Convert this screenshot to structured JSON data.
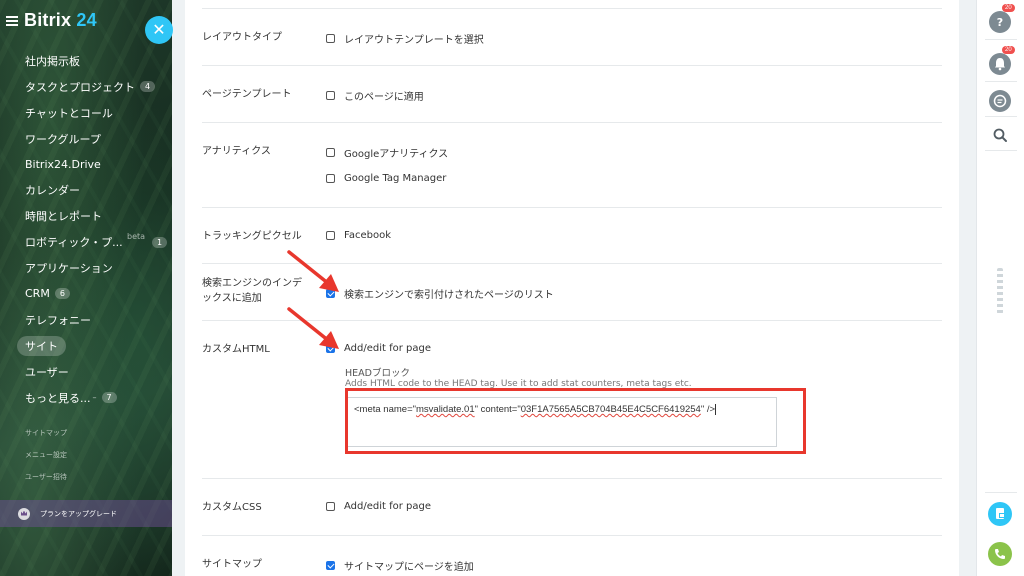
{
  "sidebar": {
    "logo_prefix": "Bitrix",
    "logo_number": "24",
    "close_glyph": "✕",
    "items": [
      {
        "label": "社内掲示板"
      },
      {
        "label": "タスクとプロジェクト",
        "count": "4"
      },
      {
        "label": "チャットとコール"
      },
      {
        "label": "ワークグループ"
      },
      {
        "label": "Bitrix24.Drive"
      },
      {
        "label": "カレンダー"
      },
      {
        "label": "時間とレポート"
      },
      {
        "label": "ロボティック・プ...",
        "beta": "beta",
        "count": "1"
      },
      {
        "label": "アプリケーション"
      },
      {
        "label": "CRM",
        "count": "6"
      },
      {
        "label": "テレフォニー"
      },
      {
        "label": "サイト"
      },
      {
        "label": "ユーザー"
      },
      {
        "label": "もっと見る...",
        "count": "7"
      }
    ],
    "small_links": [
      "サイトマップ",
      "メニュー設定",
      "ユーザー招待"
    ],
    "upgrade_label": "プランをアップグレード"
  },
  "settings": {
    "layout_type": {
      "label": "レイアウトタイプ",
      "option": "レイアウトテンプレートを選択",
      "checked": false
    },
    "page_template": {
      "label": "ページテンプレート",
      "option": "このページに適用",
      "checked": false
    },
    "analytics": {
      "label": "アナリティクス",
      "options": [
        {
          "label": "Googleアナリティクス",
          "checked": false
        },
        {
          "label": "Google Tag Manager",
          "checked": false
        }
      ]
    },
    "tracking_pixel": {
      "label": "トラッキングピクセル",
      "option": "Facebook",
      "checked": false
    },
    "search_index": {
      "label_line1": "検索エンジンのインデ",
      "label_line2": "ックスに追加",
      "option": "検索エンジンで索引付けされたページのリスト",
      "checked": true
    },
    "custom_html": {
      "label": "カスタムHTML",
      "option": "Add/edit for page",
      "checked": true,
      "head_block_title": "HEADブロック",
      "head_block_desc": "Adds HTML code to the HEAD tag. Use it to add stat counters, meta tags etc.",
      "code_prefix": "<meta name=\"",
      "code_name": "msvalidate.01",
      "code_mid": "\" content=\"",
      "code_content": "03F1A7565A5CB704B45E4C5CF6419254",
      "code_suffix": "\" />"
    },
    "custom_css": {
      "label": "カスタムCSS",
      "option": "Add/edit for page",
      "checked": false
    },
    "sitemap": {
      "label": "サイトマップ",
      "option": "サイトマップにページを追加",
      "checked": true
    }
  },
  "rail": {
    "help_badge": "20",
    "notifications_badge": "20"
  },
  "colors": {
    "accent": "#2fc6f6",
    "annotation_red": "#e8372d",
    "checkbox_blue": "#1a73e8",
    "phone_green": "#8bc34a"
  }
}
